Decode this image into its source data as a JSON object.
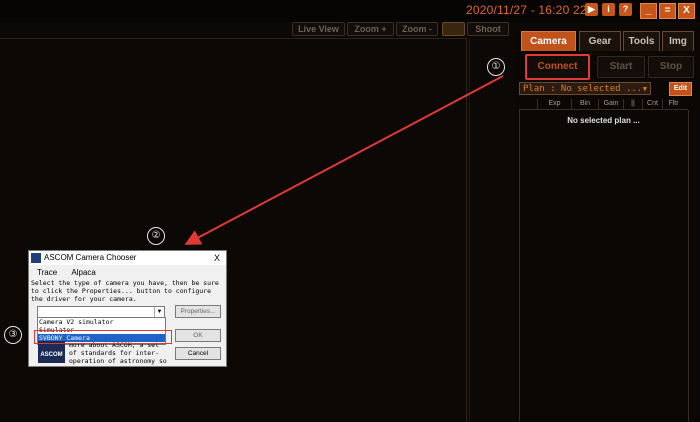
{
  "header": {
    "datetime": "2020/11/27 - 16:20 22",
    "icons": [
      "play-icon",
      "info-icon",
      "help-icon"
    ],
    "window_controls": [
      "_",
      "=",
      "X"
    ]
  },
  "toolbar": {
    "live_view": "Live View",
    "zoom_in": "Zoom +",
    "zoom_out": "Zoom -",
    "shoot": "Shoot"
  },
  "panel": {
    "tabs": [
      {
        "label": "Camera",
        "active": true
      },
      {
        "label": "Gear",
        "active": false
      },
      {
        "label": "Tools",
        "active": false
      },
      {
        "label": "Img",
        "active": false
      }
    ],
    "connect": "Connect",
    "start": "Start",
    "stop": "Stop",
    "plan_selected": "Plan : No selected ...",
    "edit": "Edit",
    "columns": [
      "Exp",
      "Bin",
      "Gain",
      "||",
      "Cnt",
      "Fltr"
    ],
    "no_plan": "No selected plan ..."
  },
  "annotations": {
    "step1": "①",
    "step2": "②",
    "step3": "③"
  },
  "dialog": {
    "title": "ASCOM Camera Chooser",
    "close": "X",
    "menu": [
      "Trace",
      "Alpaca"
    ],
    "description": "Select the type of camera you have, then be sure to click the Properties... button to configure the driver for your camera.",
    "list_items": [
      "Camera V2 simulator",
      "Simulator",
      "SVBONY Camera"
    ],
    "selected_item": "SVBONY Camera",
    "properties": "Properties...",
    "ok": "OK",
    "cancel": "Cancel",
    "logo": "ASCOM",
    "bottom_text": "more about ASCOM, a set of standards for inter-operation of astronomy so"
  },
  "colors": {
    "accent": "#c0521a",
    "highlight_red": "#e03a35",
    "background": "#0b0805"
  }
}
